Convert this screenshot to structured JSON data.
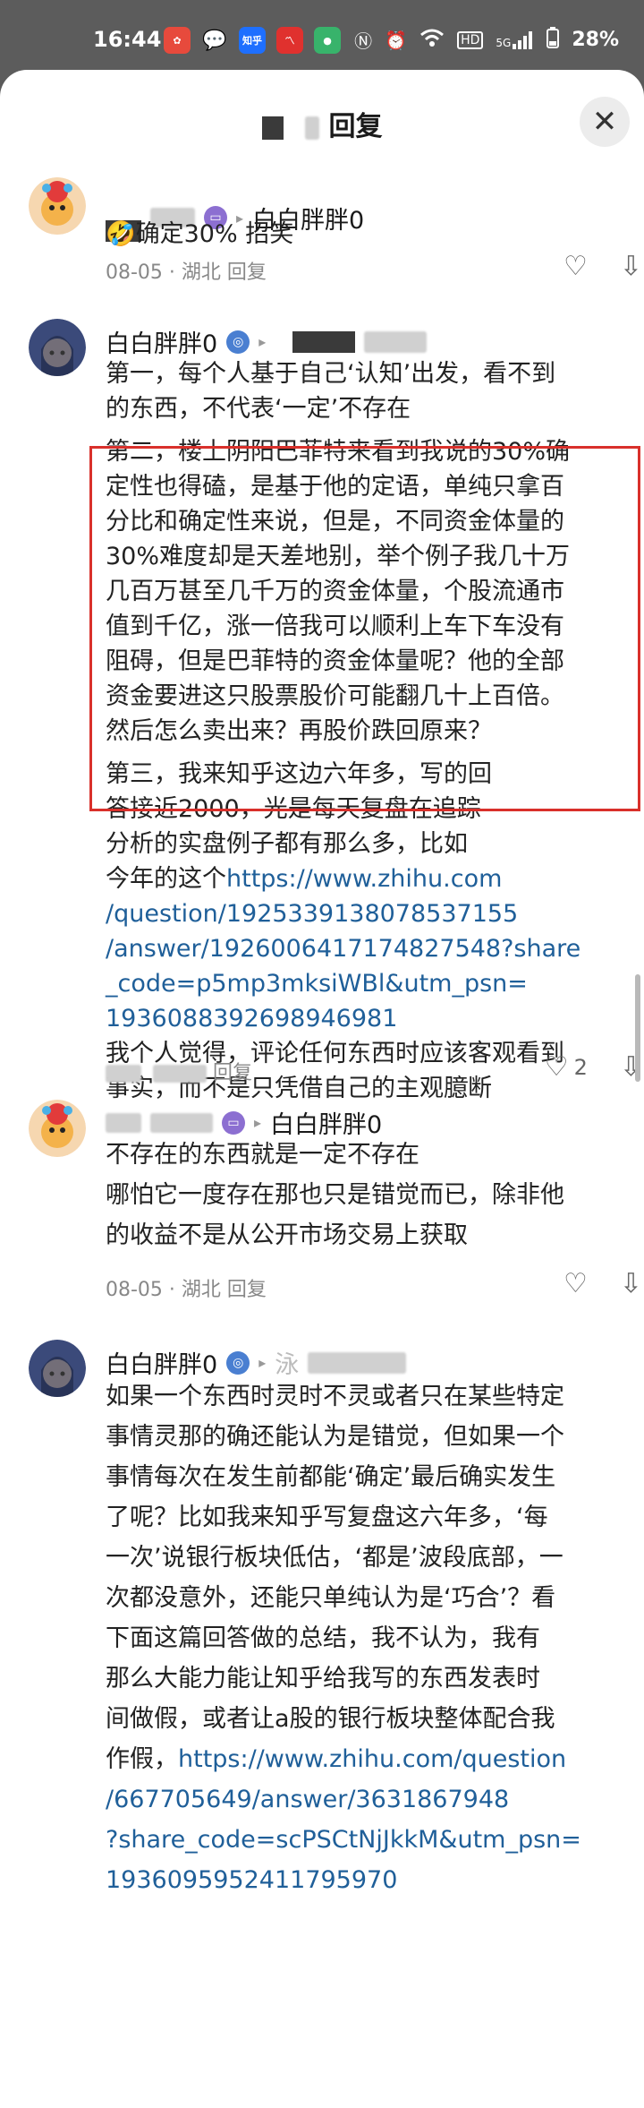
{
  "status_bar": {
    "time": "16:44",
    "battery": "28%",
    "notif_icons": [
      "red-app-icon",
      "wechat-icon",
      "zhihu-icon",
      "red-chart-icon",
      "green-app-icon"
    ],
    "notif_zhihu_label": "知乎",
    "sys_icons": [
      "nfc-icon",
      "alarm-icon",
      "wifi-icon",
      "hd-icon",
      "signal-5g-icon",
      "battery-icon"
    ],
    "hd_label": "HD",
    "signal_label": "5G"
  },
  "sheet": {
    "title": "回复",
    "close_label": "✕"
  },
  "comments": [
    {
      "author": "白白胖胖0",
      "body": [
        "🤣确定30% 招笑"
      ],
      "meta": "08-05 · 湖北 回复"
    },
    {
      "author": "白白胖胖0",
      "body": [
        "第一，每个人基于自己‘认知’出发，看不到",
        "的东西，不代表‘一定’不存在",
        "第二，楼上阴阳巴菲特来看到我说的30%确",
        "定性也得磕，是基于他的定语，单纯只拿百",
        "分比和确定性来说，但是，不同资金体量的",
        "30%难度却是天差地别，举个例子我几十万",
        "几百万甚至几千万的资金体量，个股流通市",
        "值到千亿，涨一倍我可以顺利上车下车没有",
        "阻碍，但是巴菲特的资金体量呢？他的全部",
        "资金要进这只股票股价可能翻几十上百倍。",
        "然后怎么卖出来？再股价跌回原来？",
        "第三，我来知乎这边六年多，写的回",
        "答接近2000，光是每天复盘在追踪",
        "分析的实盘例子都有那么多，比如"
      ],
      "link_prefix": "今年的这个",
      "link_lines": [
        "https://www.zhihu.com",
        "/question/1925339138078537155",
        "/answer/1926006417174827548?share",
        "_code=p5mp3mksiWBl&utm_psn=",
        "1936088392698946981"
      ],
      "body_after": [
        "我个人觉得，评论任何东西时应该客观看到",
        "事实，而不是只凭借自己的主观臆断"
      ],
      "meta": "回复",
      "likes": "2"
    },
    {
      "author": "白白胖胖0",
      "body": [
        "不存在的东西就是一定不存在",
        "哪怕它一度存在那也只是错觉而已，除非他",
        "的收益不是从公开市场交易上获取"
      ],
      "meta": "08-05 · 湖北 回复"
    },
    {
      "author": "白白胖胖0",
      "reply_to": "泳",
      "body": [
        "如果一个东西时灵时不灵或者只在某些特定",
        "事情灵那的确还能认为是错觉，但如果一个",
        "事情每次在发生前都能‘确定’最后确实发生",
        "了呢？比如我来知乎写复盘这六年多，‘每",
        "一次’说银行板块低估，‘都是’波段底部，一",
        "次都没意外，还能只单纯认为是‘巧合’？看",
        "下面这篇回答做的总结，我不认为，我有",
        "那么大能力能让知乎给我写的东西发表时",
        "间做假，或者让a股的银行板块整体配合我"
      ],
      "link_prefix": "作假，",
      "link_lines": [
        "https://www.zhihu.com/question",
        "/667705649/answer/3631867948",
        "?share_code=scPSCtNjJkkM&utm_psn=",
        "1936095952411795970"
      ]
    }
  ]
}
